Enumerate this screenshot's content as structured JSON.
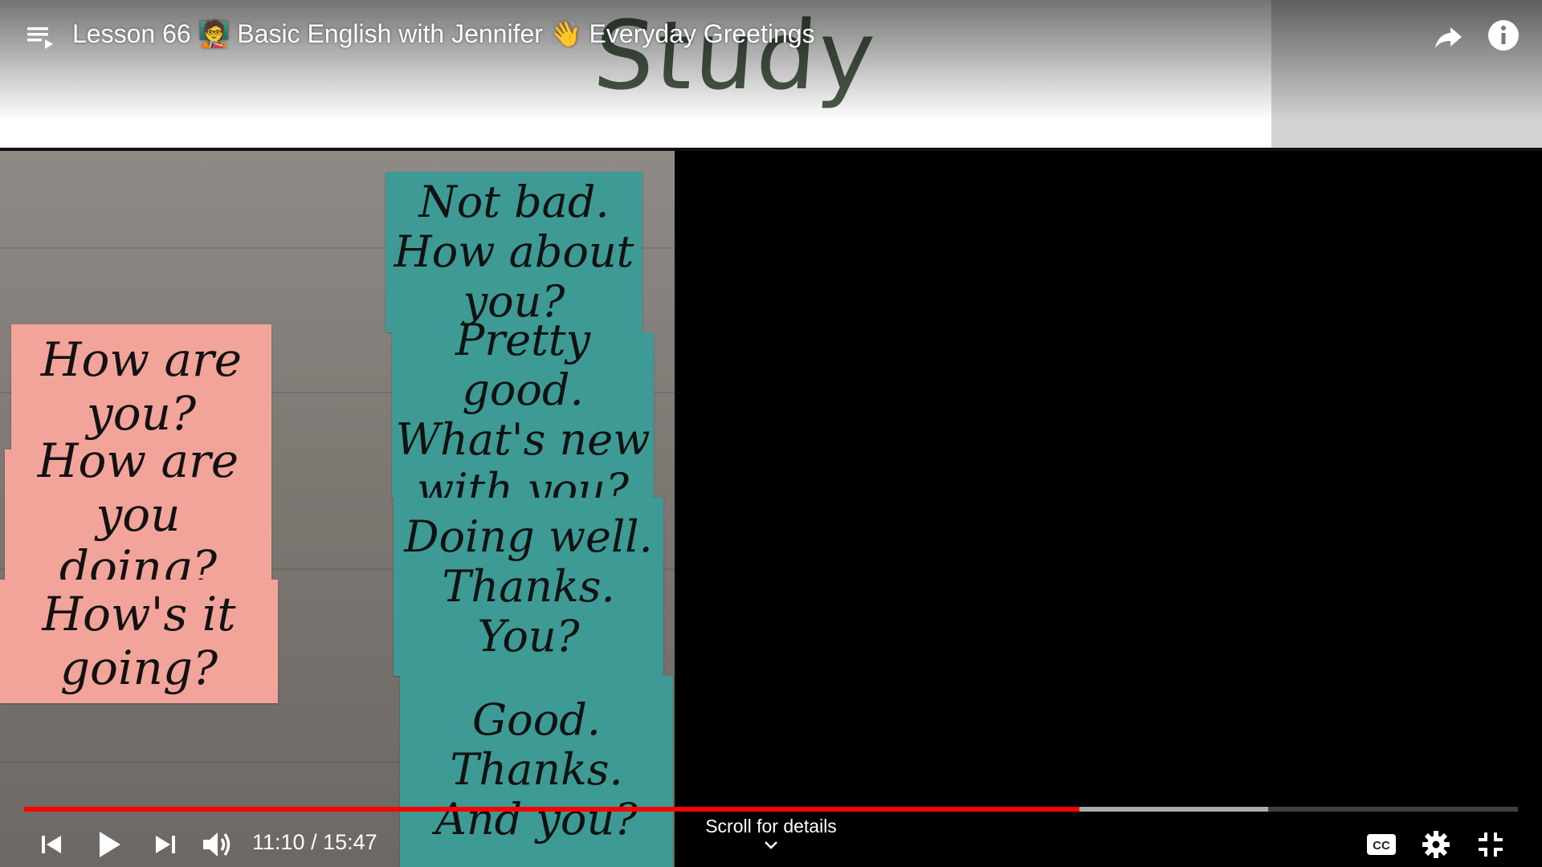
{
  "window": {
    "title": "Lesson 66 🧑‍🏫 Basic English with Jennifer 👋 Everyday Greetings"
  },
  "frame": {
    "overlay_word": "Study",
    "pink_cards": [
      {
        "lines": [
          "How are you?"
        ]
      },
      {
        "lines": [
          "How are you",
          "doing?"
        ]
      },
      {
        "lines": [
          "How's it going?"
        ]
      }
    ],
    "teal_cards": [
      {
        "lines": [
          "Not bad.",
          "How about you?"
        ]
      },
      {
        "lines": [
          "Pretty good.",
          "What's new",
          "with you?"
        ]
      },
      {
        "lines": [
          "Doing well.",
          "Thanks.",
          "You?"
        ]
      },
      {
        "lines": [
          "Good.",
          "Thanks.",
          "And you?"
        ]
      }
    ]
  },
  "player": {
    "current_time": "11:10",
    "duration": "15:47",
    "time_display": "11:10 / 15:47",
    "played_fraction": 0.7067,
    "buffered_fraction": 0.8329,
    "scroll_hint": "Scroll for details"
  },
  "icons": {
    "playlist": "playlist-icon",
    "share": "share-icon",
    "info": "info-icon",
    "previous": "skip-previous-icon",
    "play": "play-icon",
    "next": "skip-next-icon",
    "volume": "volume-icon",
    "captions": "captions-icon",
    "settings": "gear-icon",
    "exit_fullscreen": "exit-fullscreen-icon"
  },
  "colors": {
    "progress_played": "#ff0000",
    "pink_card": "#f2a49a",
    "teal_card": "#3d9a94"
  }
}
